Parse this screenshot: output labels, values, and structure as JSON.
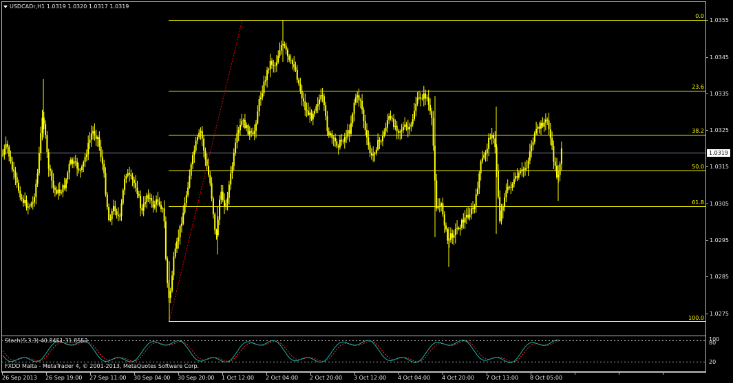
{
  "header": {
    "title": "USDCADr,H1  1.0319 1.0320 1.0317 1.0319"
  },
  "indicator": {
    "title": "Stoch(5,3,3) 40.8451 31.8553",
    "level_high": "80",
    "level_low": "20",
    "level_top": "100"
  },
  "footer": {
    "copyright": "FXDD Malta - MetaTrader 4, © 2001-2013, MetaQuotes Software Corp."
  },
  "price_axis": {
    "ticks": [
      "1.0355",
      "1.0345",
      "1.0335",
      "1.0325",
      "1.0315",
      "1.0305",
      "1.0295",
      "1.0285",
      "1.0275"
    ],
    "current": "1.0319"
  },
  "fib_levels": [
    "0.0",
    "23.6",
    "38.2",
    "50.0",
    "61.8",
    "100.0"
  ],
  "time_axis": [
    "26 Sep 2013",
    "26 Sep 19:00",
    "27 Sep 11:00",
    "30 Sep 04:00",
    "30 Sep 20:00",
    "1 Oct 12:00",
    "2 Oct 04:00",
    "2 Oct 20:00",
    "3 Oct 12:00",
    "4 Oct 04:00",
    "4 Oct 20:00",
    "7 Oct 13:00",
    "8 Oct 05:00"
  ],
  "colors": {
    "background": "#000000",
    "candles": "#ffff00",
    "fib": "#ffff00",
    "trend": "#ff0000",
    "stoch_main": "#20b2aa",
    "stoch_signal": "#ff3030",
    "grid": "#ffffff"
  }
}
